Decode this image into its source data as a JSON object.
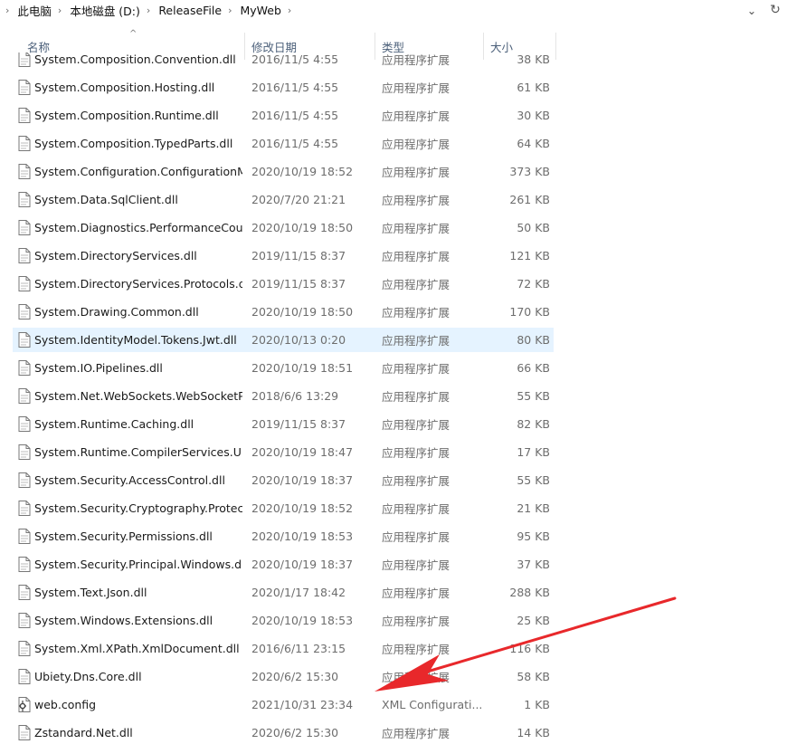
{
  "breadcrumb": [
    "此电脑",
    "本地磁盘 (D:)",
    "ReleaseFile",
    "MyWeb"
  ],
  "columns": {
    "name": "名称",
    "date": "修改日期",
    "type": "类型",
    "size": "大小"
  },
  "icons": {
    "file": "file-icon",
    "config": "config-file-icon",
    "dropdown": "chevron-down-icon",
    "refresh": "refresh-icon",
    "sort": "sort-up-icon"
  },
  "colors": {
    "selected_row": "#e5f3ff",
    "annotation_arrow": "#e8282b",
    "header_text": "#4c607a"
  },
  "files": [
    {
      "name": "System.Composition.Convention.dll",
      "date": "2016/11/5 4:55",
      "type": "应用程序扩展",
      "size": "38 KB",
      "icon": "file-icon"
    },
    {
      "name": "System.Composition.Hosting.dll",
      "date": "2016/11/5 4:55",
      "type": "应用程序扩展",
      "size": "61 KB",
      "icon": "file-icon"
    },
    {
      "name": "System.Composition.Runtime.dll",
      "date": "2016/11/5 4:55",
      "type": "应用程序扩展",
      "size": "30 KB",
      "icon": "file-icon"
    },
    {
      "name": "System.Composition.TypedParts.dll",
      "date": "2016/11/5 4:55",
      "type": "应用程序扩展",
      "size": "64 KB",
      "icon": "file-icon"
    },
    {
      "name": "System.Configuration.ConfigurationM...",
      "date": "2020/10/19 18:52",
      "type": "应用程序扩展",
      "size": "373 KB",
      "icon": "file-icon"
    },
    {
      "name": "System.Data.SqlClient.dll",
      "date": "2020/7/20 21:21",
      "type": "应用程序扩展",
      "size": "261 KB",
      "icon": "file-icon"
    },
    {
      "name": "System.Diagnostics.PerformanceCou...",
      "date": "2020/10/19 18:50",
      "type": "应用程序扩展",
      "size": "50 KB",
      "icon": "file-icon"
    },
    {
      "name": "System.DirectoryServices.dll",
      "date": "2019/11/15 8:37",
      "type": "应用程序扩展",
      "size": "121 KB",
      "icon": "file-icon"
    },
    {
      "name": "System.DirectoryServices.Protocols.dll",
      "date": "2019/11/15 8:37",
      "type": "应用程序扩展",
      "size": "72 KB",
      "icon": "file-icon"
    },
    {
      "name": "System.Drawing.Common.dll",
      "date": "2020/10/19 18:50",
      "type": "应用程序扩展",
      "size": "170 KB",
      "icon": "file-icon"
    },
    {
      "name": "System.IdentityModel.Tokens.Jwt.dll",
      "date": "2020/10/13 0:20",
      "type": "应用程序扩展",
      "size": "80 KB",
      "icon": "file-icon",
      "selected": true
    },
    {
      "name": "System.IO.Pipelines.dll",
      "date": "2020/10/19 18:51",
      "type": "应用程序扩展",
      "size": "66 KB",
      "icon": "file-icon"
    },
    {
      "name": "System.Net.WebSockets.WebSocketP...",
      "date": "2018/6/6 13:29",
      "type": "应用程序扩展",
      "size": "55 KB",
      "icon": "file-icon"
    },
    {
      "name": "System.Runtime.Caching.dll",
      "date": "2019/11/15 8:37",
      "type": "应用程序扩展",
      "size": "82 KB",
      "icon": "file-icon"
    },
    {
      "name": "System.Runtime.CompilerServices.Un...",
      "date": "2020/10/19 18:47",
      "type": "应用程序扩展",
      "size": "17 KB",
      "icon": "file-icon"
    },
    {
      "name": "System.Security.AccessControl.dll",
      "date": "2020/10/19 18:37",
      "type": "应用程序扩展",
      "size": "55 KB",
      "icon": "file-icon"
    },
    {
      "name": "System.Security.Cryptography.Protect...",
      "date": "2020/10/19 18:52",
      "type": "应用程序扩展",
      "size": "21 KB",
      "icon": "file-icon"
    },
    {
      "name": "System.Security.Permissions.dll",
      "date": "2020/10/19 18:53",
      "type": "应用程序扩展",
      "size": "95 KB",
      "icon": "file-icon"
    },
    {
      "name": "System.Security.Principal.Windows.dll",
      "date": "2020/10/19 18:37",
      "type": "应用程序扩展",
      "size": "37 KB",
      "icon": "file-icon"
    },
    {
      "name": "System.Text.Json.dll",
      "date": "2020/1/17 18:42",
      "type": "应用程序扩展",
      "size": "288 KB",
      "icon": "file-icon"
    },
    {
      "name": "System.Windows.Extensions.dll",
      "date": "2020/10/19 18:53",
      "type": "应用程序扩展",
      "size": "25 KB",
      "icon": "file-icon"
    },
    {
      "name": "System.Xml.XPath.XmlDocument.dll",
      "date": "2016/6/11 23:15",
      "type": "应用程序扩展",
      "size": "116 KB",
      "icon": "file-icon"
    },
    {
      "name": "Ubiety.Dns.Core.dll",
      "date": "2020/6/2 15:30",
      "type": "应用程序扩展",
      "size": "58 KB",
      "icon": "file-icon"
    },
    {
      "name": "web.config",
      "date": "2021/10/31 23:34",
      "type": "XML Configurati...",
      "size": "1 KB",
      "icon": "config-file-icon"
    },
    {
      "name": "Zstandard.Net.dll",
      "date": "2020/6/2 15:30",
      "type": "应用程序扩展",
      "size": "14 KB",
      "icon": "file-icon"
    }
  ]
}
